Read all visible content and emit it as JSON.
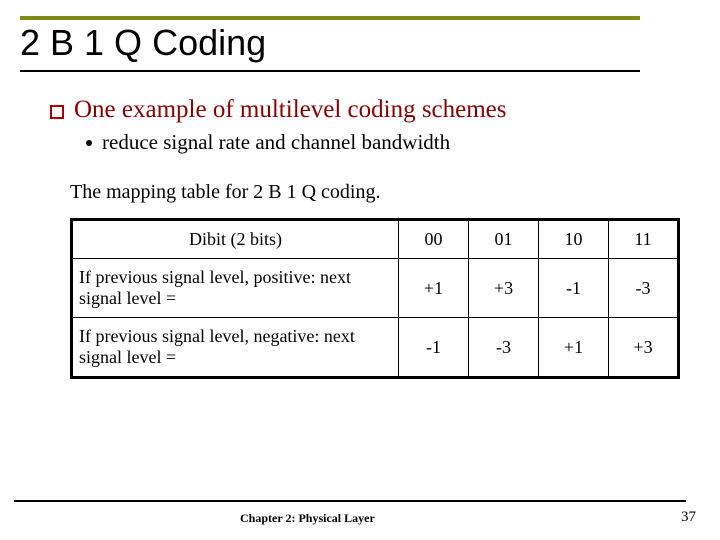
{
  "title": "2 B 1 Q Coding",
  "bullet": {
    "main": "One example of multilevel coding schemes",
    "sub": "reduce signal rate and channel bandwidth"
  },
  "table_caption": "The mapping table for 2 B 1 Q coding.",
  "table": {
    "header": {
      "label": "Dibit (2 bits)",
      "cols": [
        "00",
        "01",
        "10",
        "11"
      ]
    },
    "rows": [
      {
        "label": "If previous signal level, positive: next signal level =",
        "vals": [
          "+1",
          "+3",
          "-1",
          "-3"
        ]
      },
      {
        "label": "If previous signal level, negative: next signal level =",
        "vals": [
          "-1",
          "-3",
          "+1",
          "+3"
        ]
      }
    ]
  },
  "footer": {
    "chapter": "Chapter 2: Physical Layer",
    "page": "37"
  },
  "chart_data": {
    "type": "table",
    "title": "2B1Q mapping",
    "columns": [
      "Dibit",
      "00",
      "01",
      "10",
      "11"
    ],
    "series": [
      {
        "name": "prev positive → next level",
        "values": [
          1,
          3,
          -1,
          -3
        ]
      },
      {
        "name": "prev negative → next level",
        "values": [
          -1,
          -3,
          1,
          3
        ]
      }
    ]
  }
}
